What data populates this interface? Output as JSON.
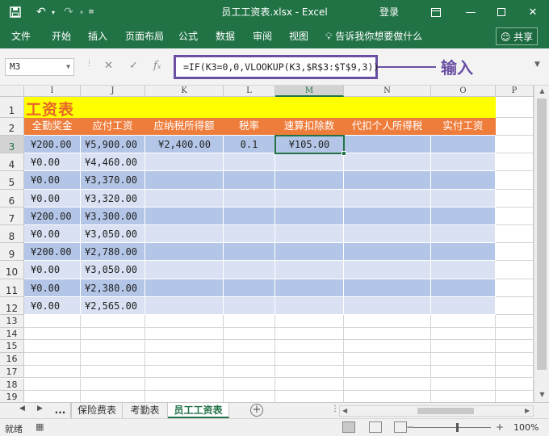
{
  "window": {
    "title": "员工工资表.xlsx  -  Excel",
    "login": "登录",
    "qa_save_icon": "save-icon",
    "qa_undo_icon": "undo-icon",
    "qa_redo_icon": "redo-icon"
  },
  "ribbon": {
    "tabs": [
      "文件",
      "开始",
      "插入",
      "页面布局",
      "公式",
      "数据",
      "审阅",
      "视图"
    ],
    "tell_me": "告诉我你想要做什么",
    "share": "共享"
  },
  "formula_bar": {
    "name_box": "M3",
    "formula": "=IF(K3=0,0,VLOOKUP(K3,$R$3:$T$9,3))",
    "callout": "输入"
  },
  "sheet": {
    "columns": [
      "I",
      "J",
      "K",
      "L",
      "M",
      "N",
      "O",
      "P"
    ],
    "selected_column": "M",
    "selected_row": "3",
    "title": "工资表",
    "headers": [
      "全勤奖金",
      "应付工资",
      "应纳税所得额",
      "税率",
      "速算扣除数",
      "代扣个人所得税",
      "实付工资"
    ],
    "row_numbers": [
      "1",
      "2",
      "3",
      "4",
      "5",
      "6",
      "7",
      "8",
      "9",
      "10",
      "11",
      "12",
      "13",
      "14",
      "15",
      "16",
      "17",
      "18",
      "19"
    ],
    "rows": [
      {
        "bonus": "¥200.00",
        "payable": "¥5,900.00",
        "taxable": "¥2,400.00",
        "rate": "0.1",
        "deduction": "¥105.00",
        "tax": "",
        "net": ""
      },
      {
        "bonus": "¥0.00",
        "payable": "¥4,460.00",
        "taxable": "",
        "rate": "",
        "deduction": "",
        "tax": "",
        "net": ""
      },
      {
        "bonus": "¥0.00",
        "payable": "¥3,370.00",
        "taxable": "",
        "rate": "",
        "deduction": "",
        "tax": "",
        "net": ""
      },
      {
        "bonus": "¥0.00",
        "payable": "¥3,320.00",
        "taxable": "",
        "rate": "",
        "deduction": "",
        "tax": "",
        "net": ""
      },
      {
        "bonus": "¥200.00",
        "payable": "¥3,300.00",
        "taxable": "",
        "rate": "",
        "deduction": "",
        "tax": "",
        "net": ""
      },
      {
        "bonus": "¥0.00",
        "payable": "¥3,050.00",
        "taxable": "",
        "rate": "",
        "deduction": "",
        "tax": "",
        "net": ""
      },
      {
        "bonus": "¥200.00",
        "payable": "¥2,780.00",
        "taxable": "",
        "rate": "",
        "deduction": "",
        "tax": "",
        "net": ""
      },
      {
        "bonus": "¥0.00",
        "payable": "¥3,050.00",
        "taxable": "",
        "rate": "",
        "deduction": "",
        "tax": "",
        "net": ""
      },
      {
        "bonus": "¥0.00",
        "payable": "¥2,380.00",
        "taxable": "",
        "rate": "",
        "deduction": "",
        "tax": "",
        "net": ""
      },
      {
        "bonus": "¥0.00",
        "payable": "¥2,565.00",
        "taxable": "",
        "rate": "",
        "deduction": "",
        "tax": "",
        "net": ""
      }
    ]
  },
  "sheet_tabs": {
    "more": "...",
    "tabs": [
      "保险费表",
      "考勤表",
      "员工工资表"
    ],
    "active": "员工工资表"
  },
  "status": {
    "ready": "就绪",
    "zoom": "100%"
  },
  "colors": {
    "accent": "#217346",
    "header_orange": "#ee7c3a",
    "title_yellow": "#ffff00",
    "band_dark": "#b4c6e7",
    "band_light": "#d9e1f2",
    "callout_purple": "#6a4fa3"
  }
}
